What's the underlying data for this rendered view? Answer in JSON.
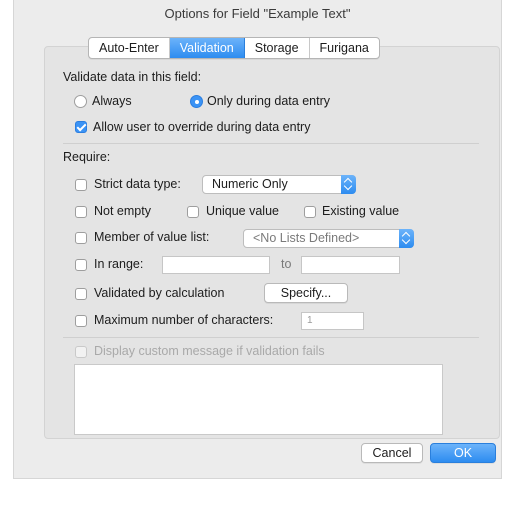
{
  "window": {
    "title": "Options for Field \"Example Text\""
  },
  "tabs": [
    {
      "label": "Auto-Enter",
      "active": false
    },
    {
      "label": "Validation",
      "active": true
    },
    {
      "label": "Storage",
      "active": false
    },
    {
      "label": "Furigana",
      "active": false
    }
  ],
  "validate": {
    "heading": "Validate data in this field:",
    "always_label": "Always",
    "always_selected": false,
    "only_entry_label": "Only during data entry",
    "only_entry_selected": true,
    "override_label": "Allow user to override during data entry",
    "override_checked": true
  },
  "require": {
    "heading": "Require:",
    "strict_type_label": "Strict data type:",
    "strict_type_value": "Numeric Only",
    "not_empty_label": "Not empty",
    "unique_label": "Unique value",
    "existing_label": "Existing value",
    "member_label": "Member of value list:",
    "member_value": "<No Lists Defined>",
    "range_label": "In range:",
    "range_to": "to",
    "range_from_value": "",
    "range_to_value": "",
    "calc_label": "Validated by calculation",
    "specify_label": "Specify...",
    "max_chars_label": "Maximum number of characters:",
    "max_chars_value": "1"
  },
  "message": {
    "label": "Display custom message if validation fails",
    "text": ""
  },
  "buttons": {
    "cancel": "Cancel",
    "ok": "OK"
  },
  "colors": {
    "accent": "#3b93f5",
    "window_bg": "#ececec",
    "panel_bg": "#e4e4e4"
  }
}
